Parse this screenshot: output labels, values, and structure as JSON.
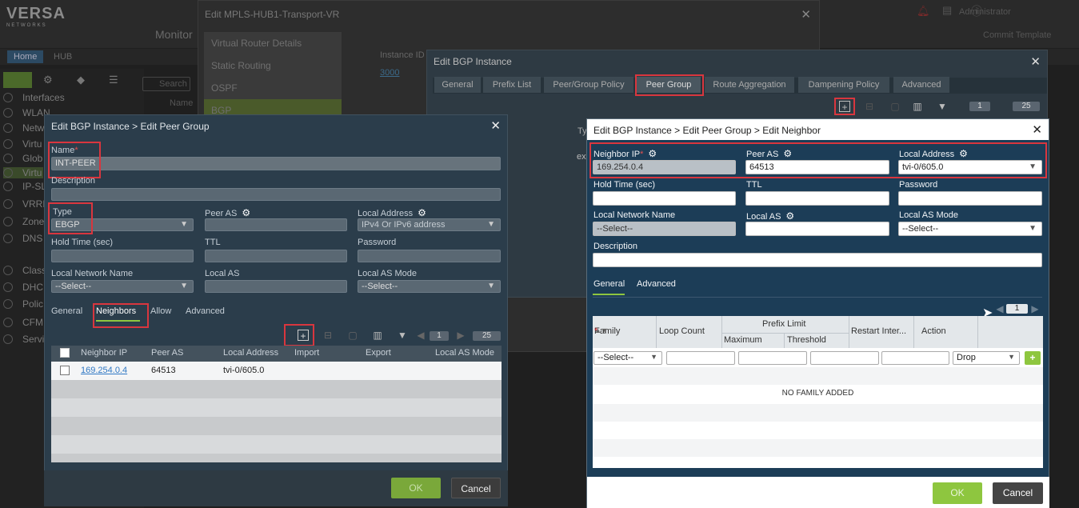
{
  "app": {
    "logo": "VERSA",
    "logo_sub": "NETWORKS",
    "monitor": "Monitor",
    "user": "Administrator",
    "commit": "Commit Template",
    "home_tab": "Home",
    "org": "HUB",
    "search_placeholder": "Search",
    "nav_items": [
      "Interfaces",
      "WLAN",
      "Netw",
      "Virtu",
      "Glob",
      "Virtu",
      "IP-SL",
      "VRRF",
      "Zone",
      "DNS",
      "Class",
      "DHC",
      "Polic",
      "CFM",
      "Servi"
    ]
  },
  "vr_dialog": {
    "title": "Edit MPLS-HUB1-Transport-VR",
    "menu": [
      "Virtual Router Details",
      "Static Routing",
      "OSPF",
      "BGP"
    ],
    "table_header": "Instance ID",
    "table_value": "3000",
    "col_name": "Name"
  },
  "bgp_dialog": {
    "title": "Edit BGP Instance",
    "tabs": [
      "General",
      "Prefix List",
      "Peer/Group Policy",
      "Peer Group",
      "Route Aggregation",
      "Dampening Policy",
      "Advanced"
    ],
    "active_tab": "Peer Group",
    "page": "1",
    "page_size": "25",
    "col_ty": "Ty",
    "col_ex": "ex"
  },
  "peer_group_dialog": {
    "title": "Edit BGP Instance > Edit Peer Group",
    "name_label": "Name",
    "name_value": "INT-PEER",
    "description_label": "Description",
    "type_label": "Type",
    "type_value": "EBGP",
    "peer_as_label": "Peer AS",
    "local_address_label": "Local Address",
    "local_address_placeholder": "IPv4 Or IPv6 address",
    "hold_time_label": "Hold Time (sec)",
    "ttl_label": "TTL",
    "password_label": "Password",
    "local_network_label": "Local Network Name",
    "local_network_value": "--Select--",
    "local_as_label": "Local AS",
    "local_as_mode_label": "Local AS Mode",
    "local_as_mode_value": "--Select--",
    "tabs": [
      "General",
      "Neighbors",
      "Allow",
      "Advanced"
    ],
    "active_tab": "Neighbors",
    "page": "1",
    "page_size": "25",
    "columns": [
      "Neighbor IP",
      "Peer AS",
      "Local Address",
      "Import",
      "Export",
      "Local AS Mode"
    ],
    "rows": [
      {
        "neighbor_ip": "169.254.0.4",
        "peer_as": "64513",
        "local_address": "tvi-0/605.0"
      }
    ],
    "ok": "OK",
    "cancel": "Cancel"
  },
  "neighbor_dialog": {
    "title": "Edit BGP Instance > Edit Peer Group > Edit Neighbor",
    "neighbor_ip_label": "Neighbor IP",
    "neighbor_ip_value": "169.254.0.4",
    "peer_as_label": "Peer AS",
    "peer_as_value": "64513",
    "local_address_label": "Local Address",
    "local_address_value": "tvi-0/605.0",
    "hold_time_label": "Hold Time (sec)",
    "ttl_label": "TTL",
    "password_label": "Password",
    "local_network_label": "Local Network Name",
    "local_network_value": "--Select--",
    "local_as_label": "Local AS",
    "local_as_mode_label": "Local AS Mode",
    "local_as_mode_value": "--Select--",
    "description_label": "Description",
    "tabs": [
      "General",
      "Advanced"
    ],
    "active_tab": "General",
    "page": "1",
    "family_col": "Family",
    "loop_count_col": "Loop Count",
    "prefix_limit_col": "Prefix Limit",
    "maximum_col": "Maximum",
    "threshold_col": "Threshold",
    "restart_col": "Restart Inter...",
    "action_col": "Action",
    "family_select": "--Select--",
    "action_select": "Drop",
    "empty_text": "NO FAMILY ADDED",
    "ok": "OK",
    "cancel": "Cancel"
  },
  "colors": {
    "accent_green": "#8ec63f",
    "highlight_red": "#d9363e",
    "link_blue": "#3d8fd6"
  }
}
